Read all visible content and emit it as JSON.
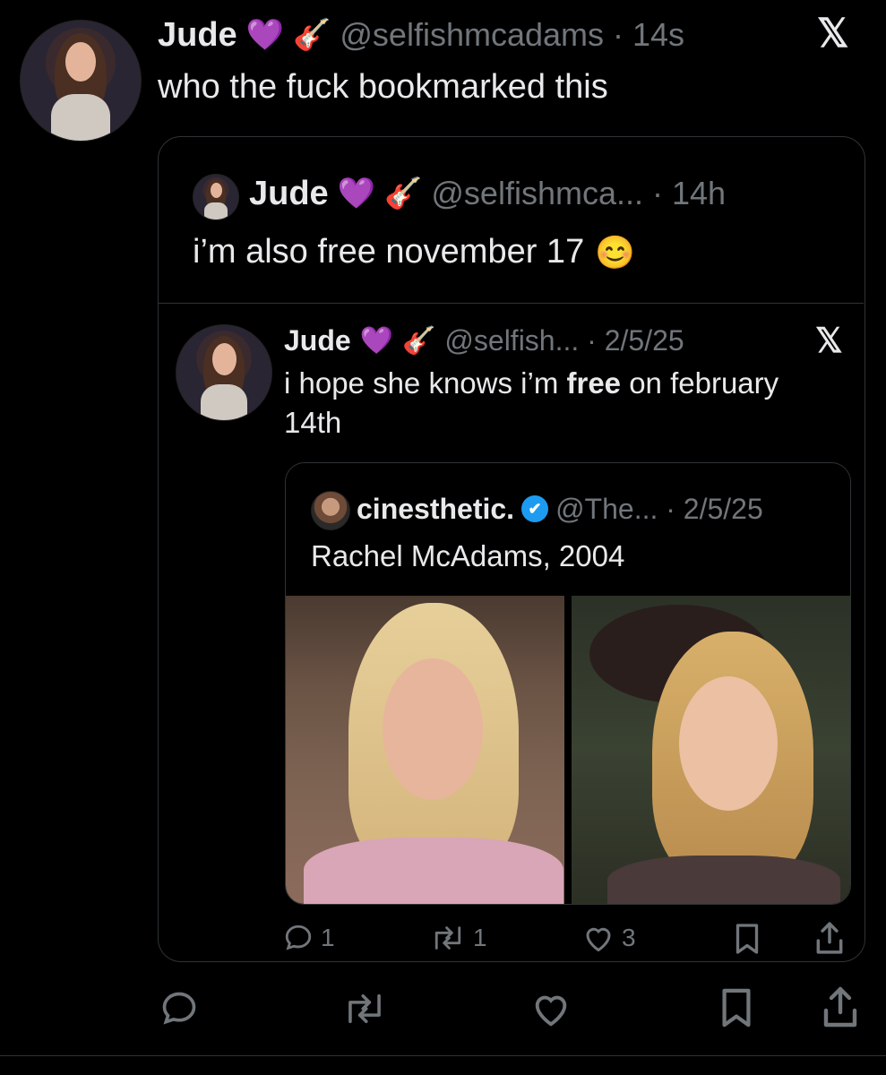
{
  "main_post": {
    "display_name": "Jude",
    "heart": "💜",
    "guitar": "🎸",
    "handle_time": "@selfishmcadams · 14s",
    "x_mark": "𝕏",
    "text": "who the fuck bookmarked this"
  },
  "quote1": {
    "display_name": "Jude",
    "heart": "💜",
    "guitar": "🎸",
    "handle_time": "@selfishmca... · 14h",
    "text": "i’m also free november 17",
    "emoji": "😊"
  },
  "quote2": {
    "display_name": "Jude",
    "heart": "💜",
    "guitar": "🎸",
    "handle_time": "@selfish... · 2/5/25",
    "x_mark": "𝕏",
    "text_before": "i hope she knows i’m ",
    "text_bold": "free",
    "text_after": " on february 14th"
  },
  "quote3": {
    "display_name": "cinesthetic.",
    "verified": "✔",
    "handle_time": "@The... · 2/5/25",
    "text": "Rachel McAdams, 2004"
  },
  "inner_actions": {
    "reply_count": "1",
    "repost_count": "1",
    "like_count": "3"
  },
  "colors": {
    "background": "#000000",
    "text": "#e7e9ea",
    "muted": "#71767b",
    "border": "#2f3336",
    "heart": "#ff4fd8",
    "verified": "#1d9bf0"
  }
}
